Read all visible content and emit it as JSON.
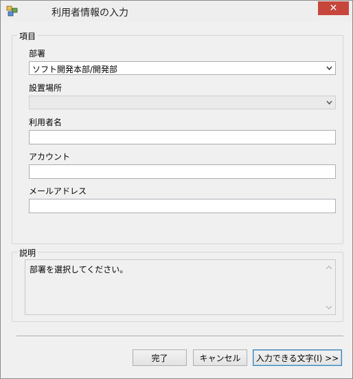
{
  "window": {
    "title": "利用者情報の入力",
    "close_glyph": "✕"
  },
  "items_group": {
    "legend": "項目",
    "department": {
      "label": "部署",
      "value": "ソフト開発本部/開発部"
    },
    "location": {
      "label": "設置場所",
      "value": ""
    },
    "user_name": {
      "label": "利用者名",
      "value": ""
    },
    "account": {
      "label": "アカウント",
      "value": ""
    },
    "email": {
      "label": "メールアドレス",
      "value": ""
    }
  },
  "description_group": {
    "legend": "説明",
    "text": "部署を選択してください。"
  },
  "buttons": {
    "finish": "完了",
    "cancel": "キャンセル",
    "input_chars": "入力できる文字(I) >>"
  },
  "colors": {
    "close_button": "#c7463c",
    "default_button_border": "#3c7fb1"
  }
}
